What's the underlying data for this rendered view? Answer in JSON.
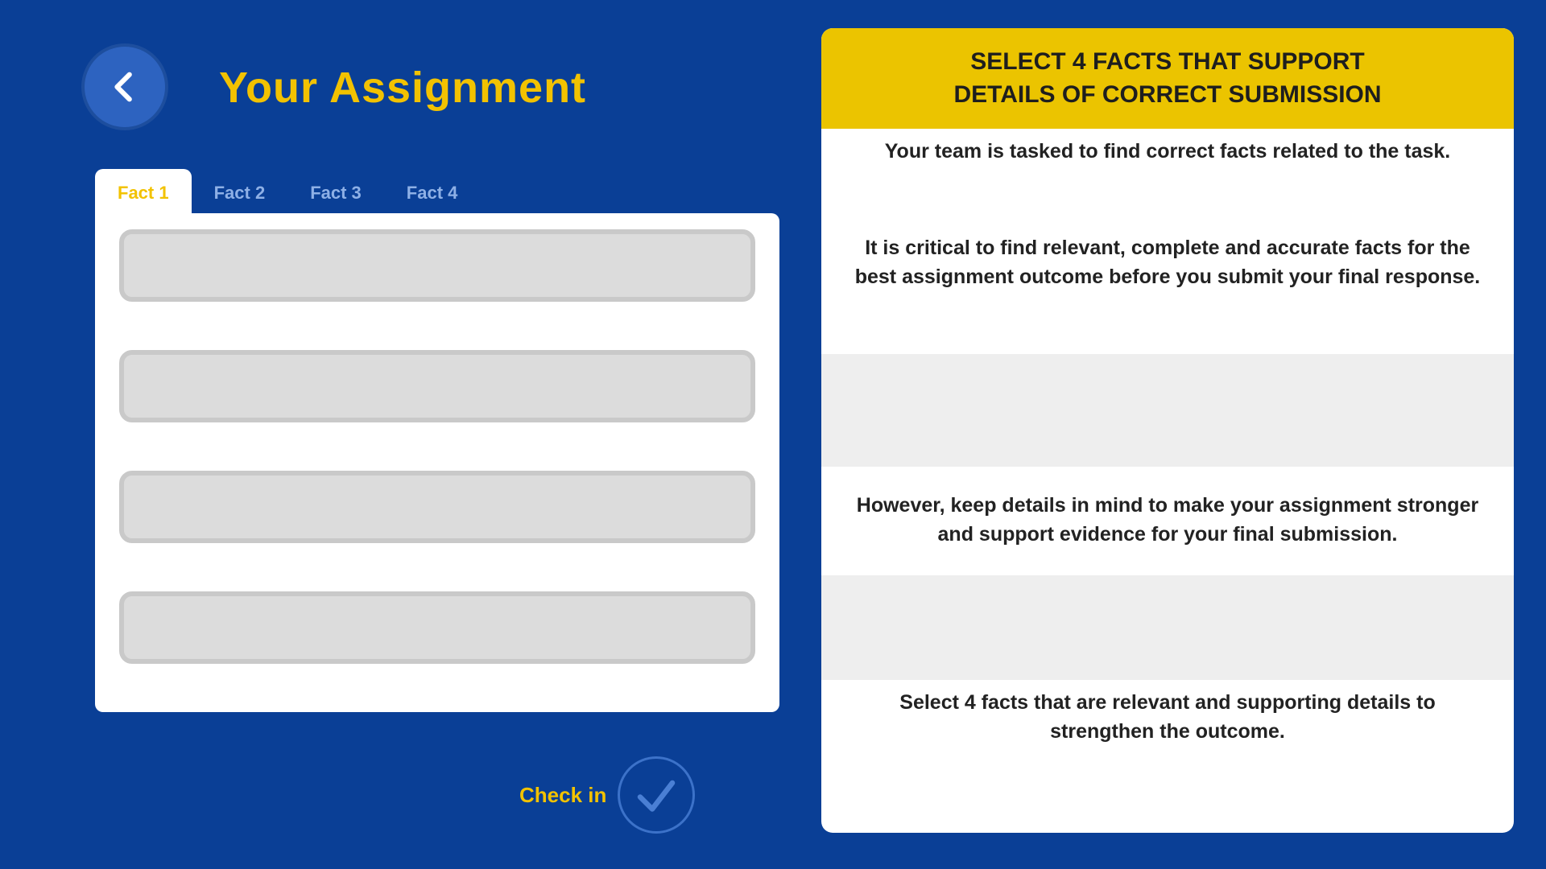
{
  "header": {
    "title": "Your Assignment",
    "back_icon": "chevron-left-icon"
  },
  "tabs": [
    {
      "label": "Fact 1"
    },
    {
      "label": "Fact 2"
    },
    {
      "label": "Fact 3"
    },
    {
      "label": "Fact 4"
    }
  ],
  "checkin": {
    "label": "Check in",
    "icon": "checkmark-icon"
  },
  "card": {
    "header_line1": "SELECT 4 FACTS THAT SUPPORT",
    "header_line2": "DETAILS OF CORRECT SUBMISSION",
    "sections": [
      {
        "text": "Your team is tasked to find correct facts related to the task."
      },
      {
        "text": "It is critical to find relevant, complete and accurate facts for the best assignment outcome before you submit your final response."
      },
      {
        "text": "However, keep details in mind to make your assignment stronger and support evidence for your final submission."
      },
      {
        "text": "Select 4 facts that are relevant and supporting details to strengthen the outcome."
      }
    ]
  },
  "colors": {
    "background": "#0a3f96",
    "accent": "#f2c200",
    "panel": "#ffffff",
    "slot": "#dcdcdc"
  }
}
